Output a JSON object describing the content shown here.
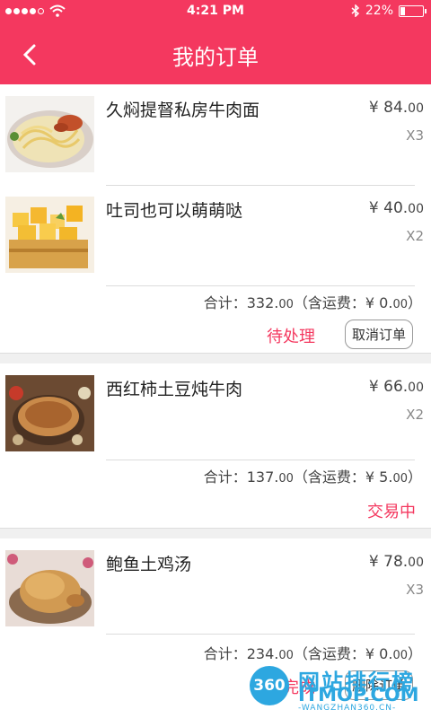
{
  "status_bar": {
    "time": "4:21 PM",
    "battery": "22%"
  },
  "header": {
    "title": "我的订单"
  },
  "orders": [
    {
      "items": [
        {
          "name": "久焖提督私房牛肉面",
          "price": "¥ 84.",
          "price_dec": "00",
          "qty": "X3"
        },
        {
          "name": "吐司也可以萌萌哒",
          "price": "¥ 40.",
          "price_dec": "00",
          "qty": "X2"
        }
      ],
      "summary": {
        "prefix": "合计：332.",
        "dec": "00",
        "shipping": "（含运费：¥ 0.",
        "shipping_dec": "00",
        "close": "）"
      },
      "status": "待处理",
      "action": "取消订单"
    },
    {
      "items": [
        {
          "name": "西红柿土豆炖牛肉",
          "price": "¥ 66.",
          "price_dec": "00",
          "qty": "X2"
        }
      ],
      "summary": {
        "prefix": "合计：137.",
        "dec": "00",
        "shipping": "（含运费：¥ 5.",
        "shipping_dec": "00",
        "close": "）"
      },
      "status": "交易中"
    },
    {
      "items": [
        {
          "name": "鲍鱼土鸡汤",
          "price": "¥ 78.",
          "price_dec": "00",
          "qty": "X3"
        }
      ],
      "summary": {
        "prefix": "合计：234.",
        "dec": "00",
        "shipping": "（含运费：¥ 0.",
        "shipping_dec": "00",
        "close": "）"
      },
      "status": "已完成",
      "action": "删除订单"
    }
  ],
  "watermark": {
    "badge": "360",
    "text": "网站排行榜",
    "domain": "ITMOP.COM",
    "small": "-WANGZHAN360.CN-"
  },
  "colors": {
    "accent": "#f4385f",
    "watermark": "#2da7e0"
  }
}
